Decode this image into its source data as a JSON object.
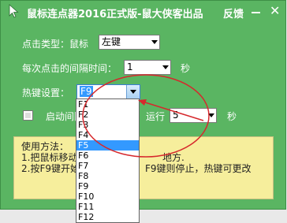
{
  "title": "鼠标连点器2016正式版-鼠大侠客出品",
  "titlebar": {
    "feedback": "反馈",
    "minimize": "—",
    "close": "✕"
  },
  "click_type": {
    "label": "点击类型：鼠标",
    "value": "左键"
  },
  "interval": {
    "label": "每次点击的间隔时间：",
    "value": "1",
    "unit": "秒"
  },
  "hotkey": {
    "label": "热键设置：",
    "value": "F9"
  },
  "autostart": {
    "label": "启动间隔",
    "suffix": "运行",
    "value": "5",
    "unit": "秒"
  },
  "usage": {
    "title": "使用方法：",
    "line1": "1.把鼠标移动",
    "line1_end": "地方.",
    "line2": "2.按F9键开始",
    "line2_end": "F9键则停止，热键可更改"
  },
  "dropdown_items": [
    "F1",
    "F2",
    "F3",
    "F4",
    "F5",
    "F6",
    "F7",
    "F8",
    "F9",
    "F10",
    "F11",
    "F12"
  ],
  "dropdown_selected": "F5",
  "colors": {
    "window_bg": "#5ab562",
    "usage_bg": "#f6ee9c",
    "annotation": "#d6282c",
    "selection": "#3399ff"
  },
  "icons": {
    "app": "mouse-cursor-icon"
  }
}
